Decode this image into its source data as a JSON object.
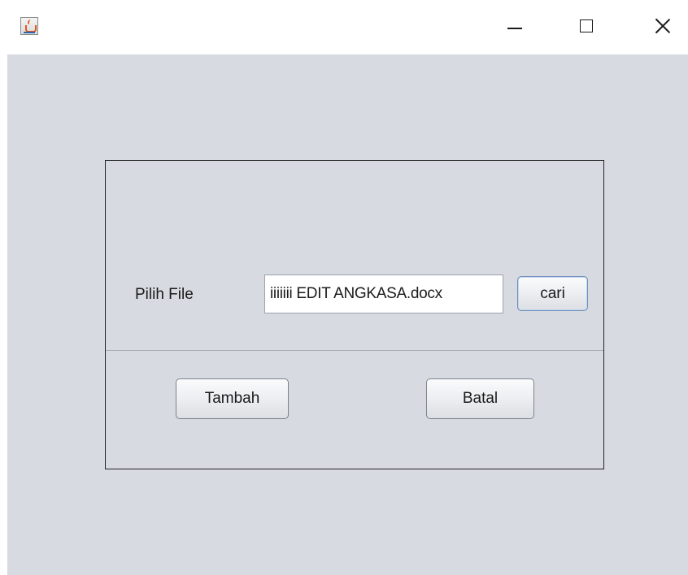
{
  "window": {
    "icon": "java-cup-icon",
    "controls": {
      "minimize": "minimize-icon",
      "maximize": "maximize-icon",
      "close": "close-icon"
    }
  },
  "form": {
    "file_label": "Pilih File",
    "file_value": "iiiiiii EDIT ANGKASA.docx",
    "browse_label": "cari",
    "add_label": "Tambah",
    "cancel_label": "Batal"
  },
  "colors": {
    "content_bg": "#d7dae0",
    "panel_border": "#222222",
    "focus_border": "#6c8fbd"
  }
}
